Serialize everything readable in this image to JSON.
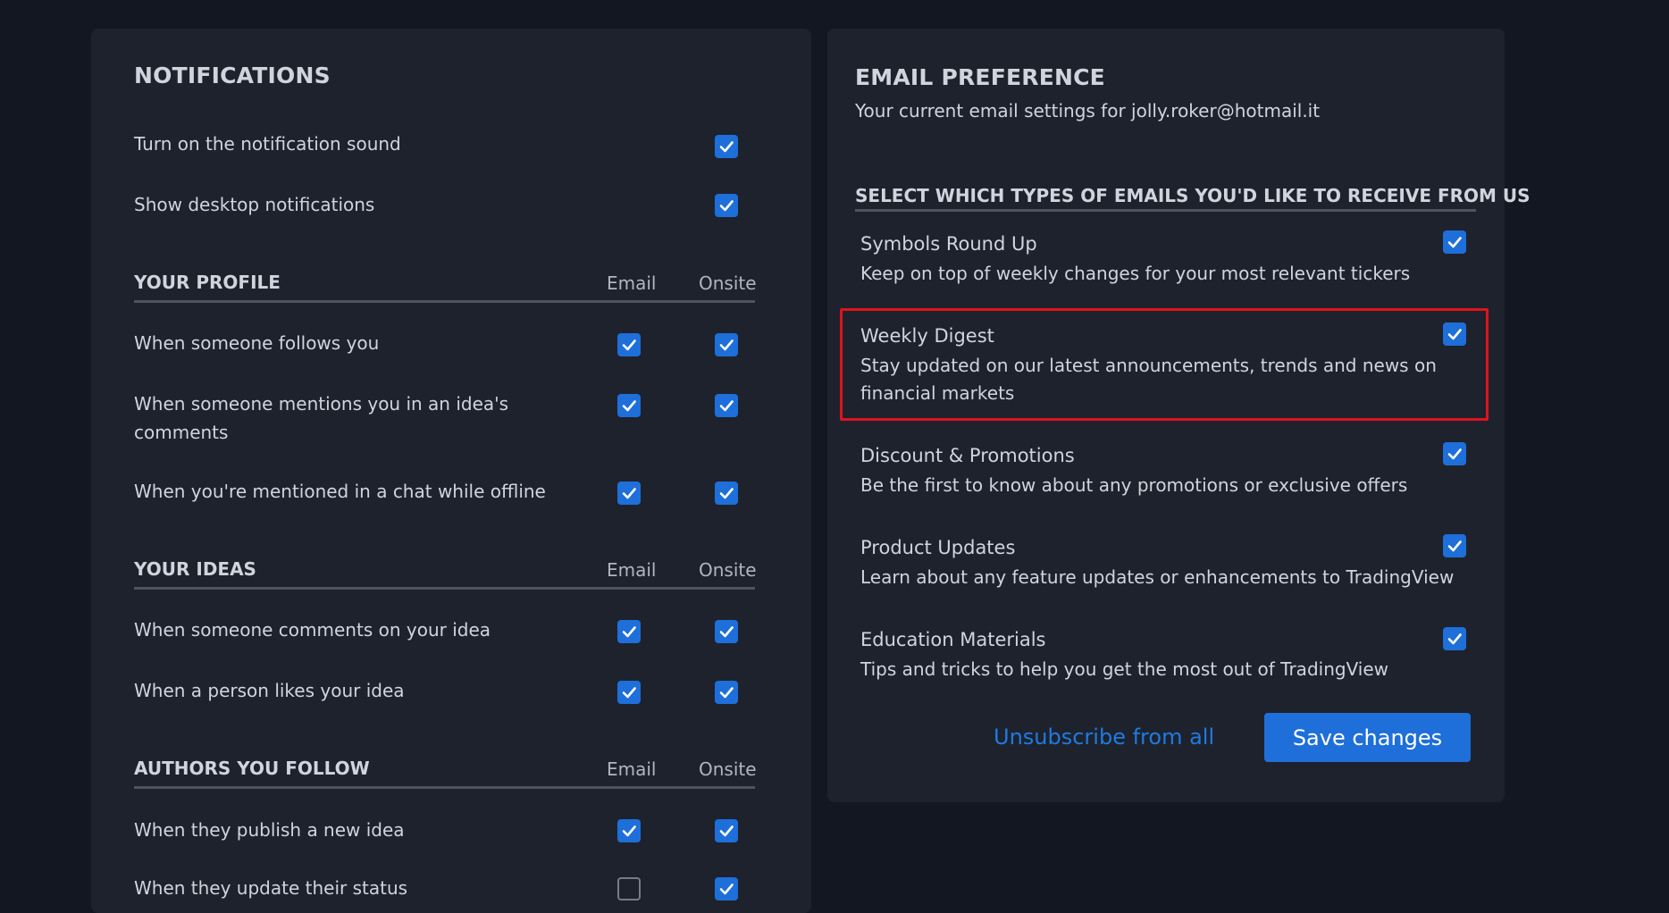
{
  "notifications": {
    "title": "NOTIFICATIONS",
    "items": [
      {
        "label": "Turn on the notification sound",
        "checked": true
      },
      {
        "label": "Show desktop notifications",
        "checked": true
      }
    ]
  },
  "your_profile": {
    "title": "YOUR PROFILE",
    "col_email": "Email",
    "col_onsite": "Onsite",
    "rows": [
      {
        "label": "When someone follows you",
        "email": true,
        "onsite": true
      },
      {
        "label_line1": "When someone mentions you in an idea's",
        "label_line2": "comments",
        "email": true,
        "onsite": true
      },
      {
        "label": "When you're mentioned in a chat while offline",
        "email": true,
        "onsite": true
      }
    ]
  },
  "your_ideas": {
    "title": "YOUR IDEAS",
    "col_email": "Email",
    "col_onsite": "Onsite",
    "rows": [
      {
        "label": "When someone comments on your idea",
        "email": true,
        "onsite": true
      },
      {
        "label": "When a person likes your idea",
        "email": true,
        "onsite": true
      }
    ]
  },
  "authors_you_follow": {
    "title": "AUTHORS YOU FOLLOW",
    "col_email": "Email",
    "col_onsite": "Onsite",
    "rows": [
      {
        "label": "When they publish a new idea",
        "email": true,
        "onsite": true
      },
      {
        "label": "When they update their status",
        "email": false,
        "onsite": true
      }
    ]
  },
  "email_preference": {
    "title": "EMAIL PREFERENCE",
    "subtitle": "Your current email settings for jolly.roker@hotmail.it",
    "section_title": "SELECT WHICH TYPES OF EMAILS YOU'D LIKE TO RECEIVE FROM US",
    "types": [
      {
        "title": "Symbols Round Up",
        "desc": "Keep on top of weekly changes for your most relevant tickers",
        "checked": true
      },
      {
        "title": "Weekly Digest",
        "desc_line1": "Stay updated on our latest announcements, trends and news on",
        "desc_line2": "financial markets",
        "checked": true
      },
      {
        "title": "Discount & Promotions",
        "desc": "Be the first to know about any promotions or exclusive offers",
        "checked": true
      },
      {
        "title": "Product Updates",
        "desc": "Learn about any feature updates or enhancements to TradingView",
        "checked": true
      },
      {
        "title": "Education Materials",
        "desc": "Tips and tricks to help you get the most out of TradingView",
        "checked": true
      }
    ],
    "unsubscribe_label": "Unsubscribe from all",
    "save_label": "Save changes"
  },
  "colors": {
    "accent": "#1e6fd9",
    "highlight": "#e0131c",
    "background": "#131722",
    "panel": "#1e222d"
  },
  "icons": {
    "check": "check-icon"
  }
}
